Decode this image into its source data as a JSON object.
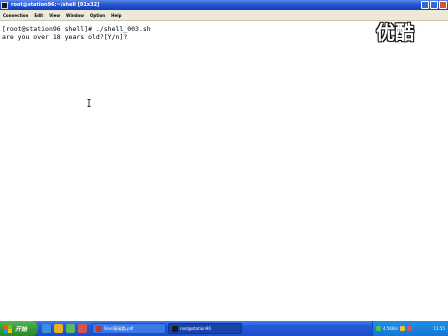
{
  "window": {
    "title": "root@station96:~/shell [91x32]"
  },
  "menu": {
    "items": [
      {
        "label": "Connection"
      },
      {
        "label": "Edit"
      },
      {
        "label": "View"
      },
      {
        "label": "Window"
      },
      {
        "label": "Option"
      },
      {
        "label": "Help"
      }
    ]
  },
  "terminal": {
    "lines": [
      "[root@station96 shell]# ./shell_003.sh",
      "are you over 18 years old?[Y/n]?"
    ]
  },
  "watermark": {
    "text": "优酷"
  },
  "taskbar": {
    "start_label": "开始",
    "tasks": [
      {
        "label": "Shell基础篇.pdf",
        "icon_color": "#c0392b"
      },
      {
        "label": "root@station96",
        "icon_color": "#1a1a1a"
      }
    ],
    "tray_text": "4.5KB/s",
    "clock": "11:55"
  },
  "colors": {
    "titlebar": "#2a5bd7",
    "taskbar": "#2458d6",
    "start_button": "#379a34",
    "terminal_bg": "#ffffff",
    "terminal_fg": "#000000"
  }
}
